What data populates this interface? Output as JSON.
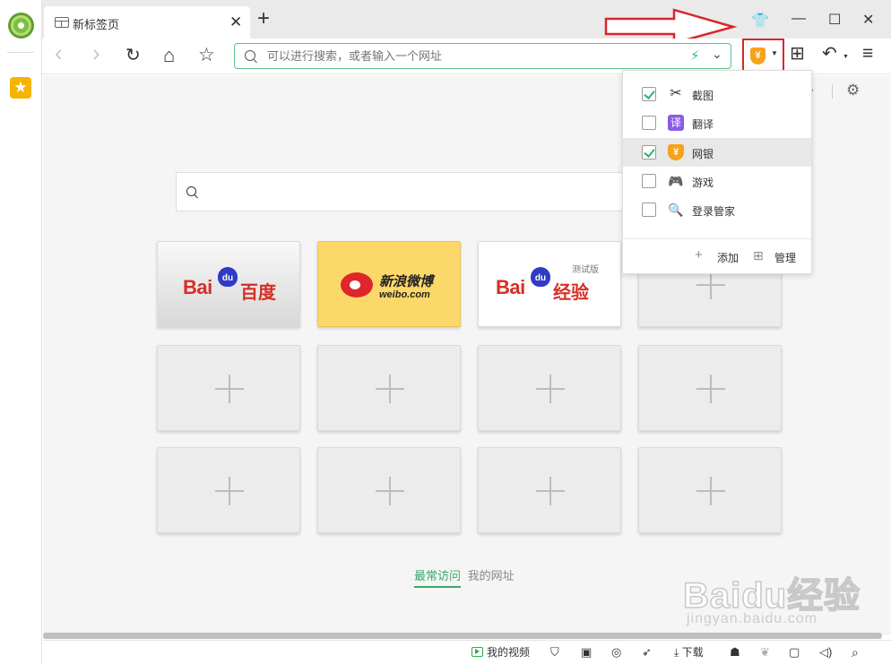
{
  "tab": {
    "title": "新标签页",
    "close": "✕",
    "new": "+"
  },
  "window": {
    "skin": "👕",
    "minimize": "—",
    "maximize": "☐",
    "close": "✕"
  },
  "toolbar": {
    "back": "‹",
    "forward": "›",
    "refresh": "↻",
    "home": "⌂",
    "star": "☆",
    "address_placeholder": "可以进行搜索，或者输入一个网址",
    "bolt": "⚡",
    "chevron": "⌄",
    "wangyin_symbol": "¥",
    "apps": "⊞",
    "undo": "↶",
    "menu": "≡"
  },
  "speed_dial": [
    {
      "name": "baidu",
      "bai": "Bai",
      "du": "du",
      "cn": "百度"
    },
    {
      "name": "weibo",
      "cn": "新浪微博",
      "en": "weibo.com"
    },
    {
      "name": "jingyan",
      "bai": "Bai",
      "du": "du",
      "cn": "经验",
      "badge": "测试版"
    }
  ],
  "bottom_tabs": {
    "active": "最常访问",
    "other": "我的网址"
  },
  "dropdown": {
    "items": [
      {
        "label": "截图",
        "checked": true,
        "icon": "scissors-icon",
        "glyph": "✂",
        "color": "#333333"
      },
      {
        "label": "翻译",
        "checked": false,
        "icon": "translate-icon",
        "glyph": "译",
        "color": "#8b5ce6"
      },
      {
        "label": "网银",
        "checked": true,
        "icon": "wangyin-shield-icon",
        "glyph": "¥",
        "color": "#f6a21a"
      },
      {
        "label": "游戏",
        "checked": false,
        "icon": "gamepad-icon",
        "glyph": "🎮",
        "color": "#f07a22"
      },
      {
        "label": "登录管家",
        "checked": false,
        "icon": "login-key-icon",
        "glyph": "🔍",
        "color": "#3d8ee6"
      }
    ],
    "add_label": "添加",
    "manage_label": "管理"
  },
  "statusbar": {
    "video": "我的视频",
    "download": "下载"
  },
  "watermark": {
    "text": "Baidu经验",
    "url": "jingyan.baidu.com"
  },
  "colors": {
    "accent_green": "#39a86a",
    "highlight_red": "#d9262b",
    "wangyin_orange": "#f6a21a"
  }
}
